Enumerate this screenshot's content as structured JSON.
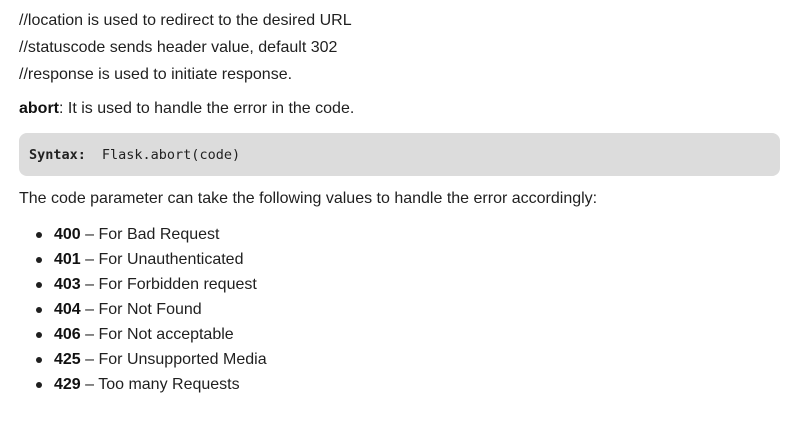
{
  "comments": [
    "//location is used to redirect to the desired URL",
    "//statuscode sends header value, default 302",
    "//response is used to initiate response."
  ],
  "abort": {
    "keyword": "abort",
    "text": ": It is used to handle the error in the code."
  },
  "syntax": {
    "label": "Syntax:",
    "code": "Flask.abort(code)"
  },
  "description": "The code parameter can take the following values to handle the error accordingly:",
  "codes": [
    {
      "code": "400",
      "sep": " – ",
      "text": "For Bad Request"
    },
    {
      "code": "401",
      "sep": " – ",
      "text": "For Unauthenticated"
    },
    {
      "code": "403",
      "sep": " – ",
      "text": "For Forbidden request"
    },
    {
      "code": "404",
      "sep": " – ",
      "text": "For Not Found"
    },
    {
      "code": "406",
      "sep": " – ",
      "text": "For Not acceptable"
    },
    {
      "code": "425",
      "sep": " – ",
      "text": "For Unsupported Media"
    },
    {
      "code": "429",
      "sep": " – ",
      "text": "Too many Requests"
    }
  ]
}
